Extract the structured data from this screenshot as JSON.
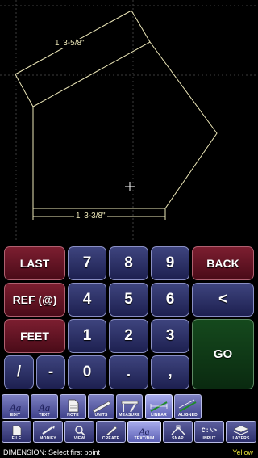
{
  "canvas": {
    "dimension_top": "1' 3-5/8\"",
    "dimension_bottom": "1' 3-3/8\"",
    "line_color": "#ece7b8",
    "grid_color": "#3c3c3c"
  },
  "keypad": {
    "last": "LAST",
    "ref": "REF (@)",
    "feet": "FEET",
    "back": "BACK",
    "left_arrow": "<",
    "go": "GO",
    "slash": "/",
    "dash": "-",
    "dot": ".",
    "comma": ",",
    "digits": [
      "0",
      "1",
      "2",
      "3",
      "4",
      "5",
      "6",
      "7",
      "8",
      "9"
    ],
    "colors": {
      "red": "#5e1424",
      "blue": "#2c3068",
      "green": "#10361a"
    }
  },
  "toolbar_top": [
    {
      "label": "EDIT",
      "icon": "text-edit-icon"
    },
    {
      "label": "TEXT",
      "icon": "text-icon"
    },
    {
      "label": "NOTE",
      "icon": "note-icon"
    },
    {
      "label": "UNITS",
      "icon": "units-ruler-icon"
    },
    {
      "label": "MEASURE",
      "icon": "measure-caliper-icon"
    },
    {
      "label": "LINEAR",
      "icon": "linear-dimension-icon"
    },
    {
      "label": "ALIGNED",
      "icon": "aligned-dimension-icon"
    }
  ],
  "toolbar_bottom": [
    {
      "label": "FILE",
      "icon": "file-icon"
    },
    {
      "label": "MODIFY",
      "icon": "modify-icon"
    },
    {
      "label": "VIEW",
      "icon": "view-icon"
    },
    {
      "label": "CREATE",
      "icon": "create-icon"
    },
    {
      "label": "TEXT/DIM",
      "icon": "text-dim-icon"
    },
    {
      "label": "SNAP",
      "icon": "snap-icon"
    },
    {
      "label": "INPUT",
      "icon": "input-terminal-icon",
      "glyph": "C:\\>"
    },
    {
      "label": "LAYERS",
      "icon": "layers-icon"
    }
  ],
  "status": {
    "message": "DIMENSION: Select first point",
    "layer_color": "Yellow"
  }
}
